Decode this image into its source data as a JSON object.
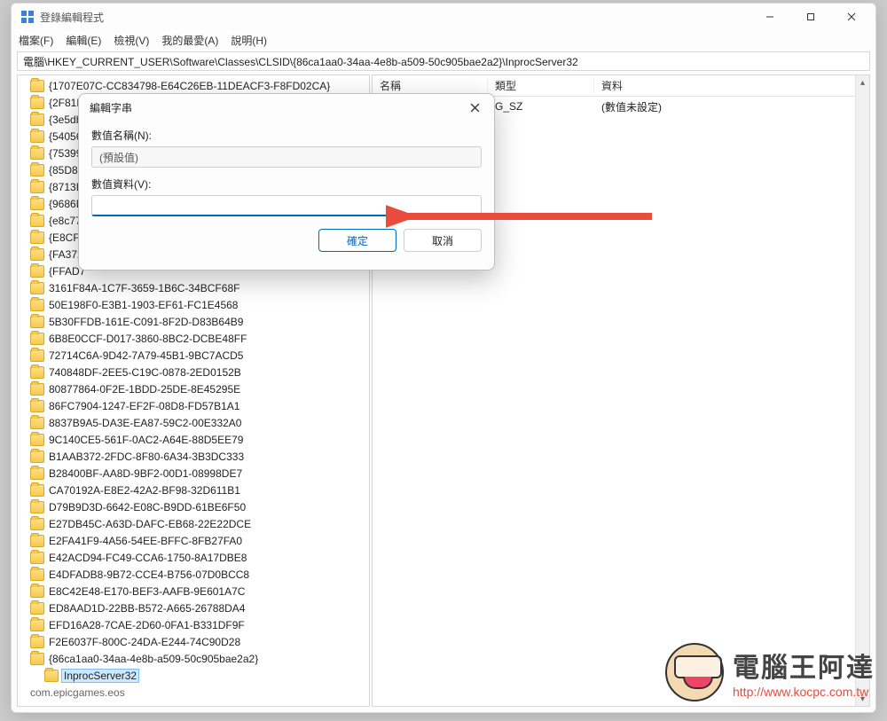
{
  "window": {
    "title": "登錄編輯程式"
  },
  "menu": {
    "file": "檔案(F)",
    "edit": "編輯(E)",
    "view": "檢視(V)",
    "fav": "我的最愛(A)",
    "help": "說明(H)"
  },
  "address": "電腦\\HKEY_CURRENT_USER\\Software\\Classes\\CLSID\\{86ca1aa0-34aa-4e8b-a509-50c905bae2a2}\\InprocServer32",
  "tree": {
    "partial": [
      "{1707E07C-CC834798-E64C26EB-11DEACF3-F8FD02CA}",
      "{2F81B2",
      "{3e5db",
      "{54056",
      "{75399",
      "{85D8E",
      "{8713E",
      "{9686D",
      "{e8c771",
      "{E8CF3",
      "{FA372",
      "{FFAD7"
    ],
    "items": [
      "3161F84A-1C7F-3659-1B6C-34BCF68F",
      "50E198F0-E3B1-1903-EF61-FC1E4568",
      "5B30FFDB-161E-C091-8F2D-D83B64B9",
      "6B8E0CCF-D017-3860-8BC2-DCBE48FF",
      "72714C6A-9D42-7A79-45B1-9BC7ACD5",
      "740848DF-2EE5-C19C-0878-2ED0152B",
      "80877864-0F2E-1BDD-25DE-8E45295E",
      "86FC7904-1247-EF2F-08D8-FD57B1A1",
      "8837B9A5-DA3E-EA87-59C2-00E332A0",
      "9C140CE5-561F-0AC2-A64E-88D5EE79",
      "B1AAB372-2FDC-8F80-6A34-3B3DC333",
      "B28400BF-AA8D-9BF2-00D1-08998DE7",
      "CA70192A-E8E2-42A2-BF98-32D611B1",
      "D79B9D3D-6642-E08C-B9DD-61BE6F50",
      "E27DB45C-A63D-DAFC-EB68-22E22DCE",
      "E2FA41F9-4A56-54EE-BFFC-8FB27FA0",
      "E42ACD94-FC49-CCA6-1750-8A17DBE8",
      "E4DFADB8-9B72-CCE4-B756-07D0BCC8",
      "E8C42E48-E170-BEF3-AAFB-9E601A7C",
      "ED8AAD1D-22BB-B572-A665-26788DA4",
      "EFD16A28-7CAE-2D60-0FA1-B331DF9F",
      "F2E6037F-800C-24DA-E244-74C90D28",
      "{86ca1aa0-34aa-4e8b-a509-50c905bae2a2}"
    ],
    "selected_child": "InprocServer32",
    "truncated": "com.epicgames.eos"
  },
  "values": {
    "headers": {
      "name": "名稱",
      "type": "類型",
      "data": "資料"
    },
    "row": {
      "name_suffix": "G_SZ",
      "data": "(數值未設定)"
    }
  },
  "dialog": {
    "title": "編輯字串",
    "name_label": "數值名稱(N):",
    "name_value": "(預設值)",
    "data_label": "數值資料(V):",
    "data_value": "",
    "ok": "確定",
    "cancel": "取消"
  },
  "watermark": {
    "name": "電腦王阿達",
    "url": "http://www.kocpc.com.tw"
  }
}
